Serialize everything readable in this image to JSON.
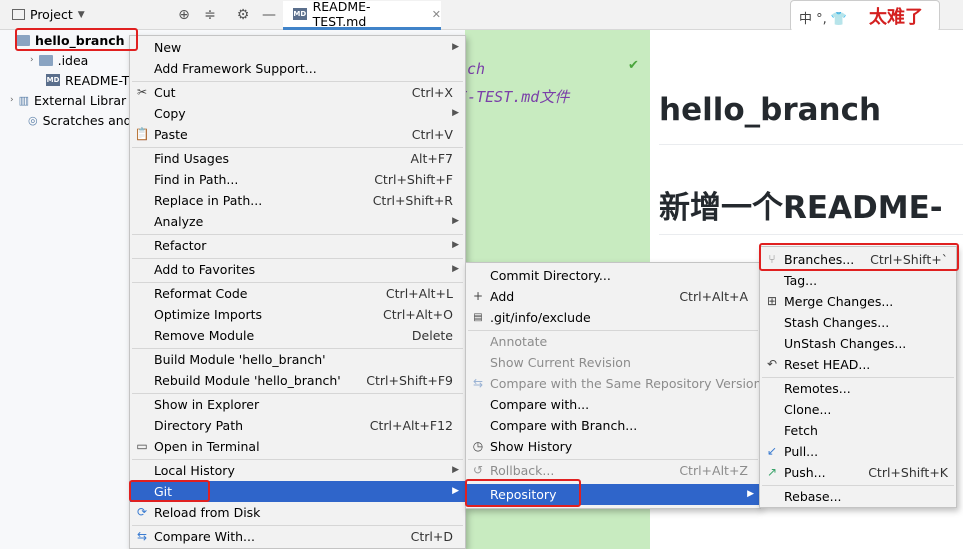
{
  "project_panel": {
    "title": "Project",
    "tree": [
      "hello_branch",
      ".idea",
      "README-TE",
      "External Librar",
      "Scratches and"
    ]
  },
  "editor": {
    "tab_label": "README-TEST.md",
    "md_badge": "MD",
    "code_line1": "ch",
    "code_line2": "DME-TEST.md文件"
  },
  "preview": {
    "heading1": "hello_branch",
    "heading2": "新增一个README-"
  },
  "ime_bar": {
    "chars": "中 °, 👕",
    "sticker": "太难了"
  },
  "context_menu": {
    "items": [
      {
        "label": "New",
        "shortcut": "",
        "submenu": true
      },
      {
        "label": "Add Framework Support...",
        "shortcut": ""
      },
      {
        "label": "Cut",
        "shortcut": "Ctrl+X",
        "icon": "✂"
      },
      {
        "label": "Copy",
        "shortcut": "",
        "submenu": true
      },
      {
        "label": "Paste",
        "shortcut": "Ctrl+V",
        "icon": "📋"
      },
      {
        "label": "Find Usages",
        "shortcut": "Alt+F7"
      },
      {
        "label": "Find in Path...",
        "shortcut": "Ctrl+Shift+F"
      },
      {
        "label": "Replace in Path...",
        "shortcut": "Ctrl+Shift+R"
      },
      {
        "label": "Analyze",
        "shortcut": "",
        "submenu": true
      },
      {
        "label": "Refactor",
        "shortcut": "",
        "submenu": true
      },
      {
        "label": "Add to Favorites",
        "shortcut": "",
        "submenu": true
      },
      {
        "label": "Reformat Code",
        "shortcut": "Ctrl+Alt+L"
      },
      {
        "label": "Optimize Imports",
        "shortcut": "Ctrl+Alt+O"
      },
      {
        "label": "Remove Module",
        "shortcut": "Delete"
      },
      {
        "label": "Build Module 'hello_branch'",
        "shortcut": ""
      },
      {
        "label": "Rebuild Module 'hello_branch'",
        "shortcut": "Ctrl+Shift+F9"
      },
      {
        "label": "Show in Explorer",
        "shortcut": ""
      },
      {
        "label": "Directory Path",
        "shortcut": "Ctrl+Alt+F12"
      },
      {
        "label": "Open in Terminal",
        "shortcut": ""
      },
      {
        "label": "Local History",
        "shortcut": "",
        "submenu": true
      },
      {
        "label": "Git",
        "shortcut": "",
        "submenu": true
      },
      {
        "label": "Reload from Disk",
        "shortcut": ""
      },
      {
        "label": "Compare With...",
        "shortcut": "Ctrl+D"
      }
    ]
  },
  "git_menu": {
    "items": [
      {
        "label": "Commit Directory...",
        "shortcut": ""
      },
      {
        "label": "Add",
        "shortcut": "Ctrl+Alt+A"
      },
      {
        "label": ".git/info/exclude",
        "shortcut": ""
      },
      {
        "label": "Annotate",
        "shortcut": ""
      },
      {
        "label": "Show Current Revision",
        "shortcut": ""
      },
      {
        "label": "Compare with the Same Repository Version",
        "shortcut": ""
      },
      {
        "label": "Compare with...",
        "shortcut": ""
      },
      {
        "label": "Compare with Branch...",
        "shortcut": ""
      },
      {
        "label": "Show History",
        "shortcut": ""
      },
      {
        "label": "Rollback...",
        "shortcut": "Ctrl+Alt+Z"
      },
      {
        "label": "Repository",
        "shortcut": ""
      }
    ]
  },
  "repository_menu": {
    "items": [
      {
        "label": "Branches...",
        "shortcut": "Ctrl+Shift+`"
      },
      {
        "label": "Tag...",
        "shortcut": ""
      },
      {
        "label": "Merge Changes...",
        "shortcut": ""
      },
      {
        "label": "Stash Changes...",
        "shortcut": ""
      },
      {
        "label": "UnStash Changes...",
        "shortcut": ""
      },
      {
        "label": "Reset HEAD...",
        "shortcut": ""
      },
      {
        "label": "Remotes...",
        "shortcut": ""
      },
      {
        "label": "Clone...",
        "shortcut": ""
      },
      {
        "label": "Fetch",
        "shortcut": ""
      },
      {
        "label": "Pull...",
        "shortcut": ""
      },
      {
        "label": "Push...",
        "shortcut": "Ctrl+Shift+K"
      },
      {
        "label": "Rebase...",
        "shortcut": ""
      }
    ]
  }
}
